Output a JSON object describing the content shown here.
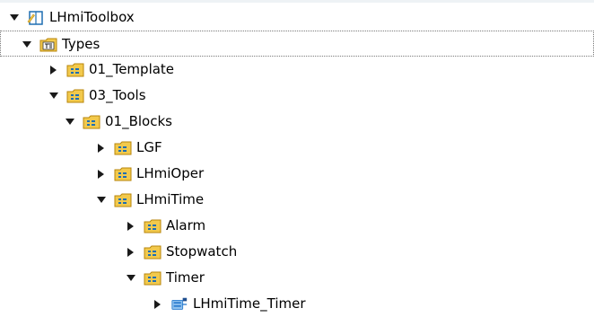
{
  "tree": {
    "root": {
      "label": "LHmiToolbox",
      "icon": "library-book-icon",
      "expanded": true
    },
    "nodes": [
      {
        "label": "Types",
        "icon": "types-folder-icon",
        "expanded": true,
        "selected": true
      },
      {
        "label": "01_Template",
        "icon": "group-folder-icon",
        "expanded": false
      },
      {
        "label": "03_Tools",
        "icon": "group-folder-icon",
        "expanded": true
      },
      {
        "label": "01_Blocks",
        "icon": "group-folder-icon",
        "expanded": true
      },
      {
        "label": "LGF",
        "icon": "group-folder-icon",
        "expanded": false
      },
      {
        "label": "LHmiOper",
        "icon": "group-folder-icon",
        "expanded": false
      },
      {
        "label": "LHmiTime",
        "icon": "group-folder-icon",
        "expanded": true
      },
      {
        "label": "Alarm",
        "icon": "group-folder-icon",
        "expanded": false
      },
      {
        "label": "Stopwatch",
        "icon": "group-folder-icon",
        "expanded": false
      },
      {
        "label": "Timer",
        "icon": "group-folder-icon",
        "expanded": true
      },
      {
        "label": "LHmiTime_Timer",
        "icon": "faceplate-type-icon",
        "expanded": false
      }
    ]
  },
  "colors": {
    "folder_fill": "#f2c94c",
    "folder_border": "#b8860b",
    "folder_glyph": "#1f6fb2",
    "faceplate_blue": "#2f7fd0",
    "selection_border": "#7a7a7a",
    "arrow": "#1a1a1a"
  }
}
